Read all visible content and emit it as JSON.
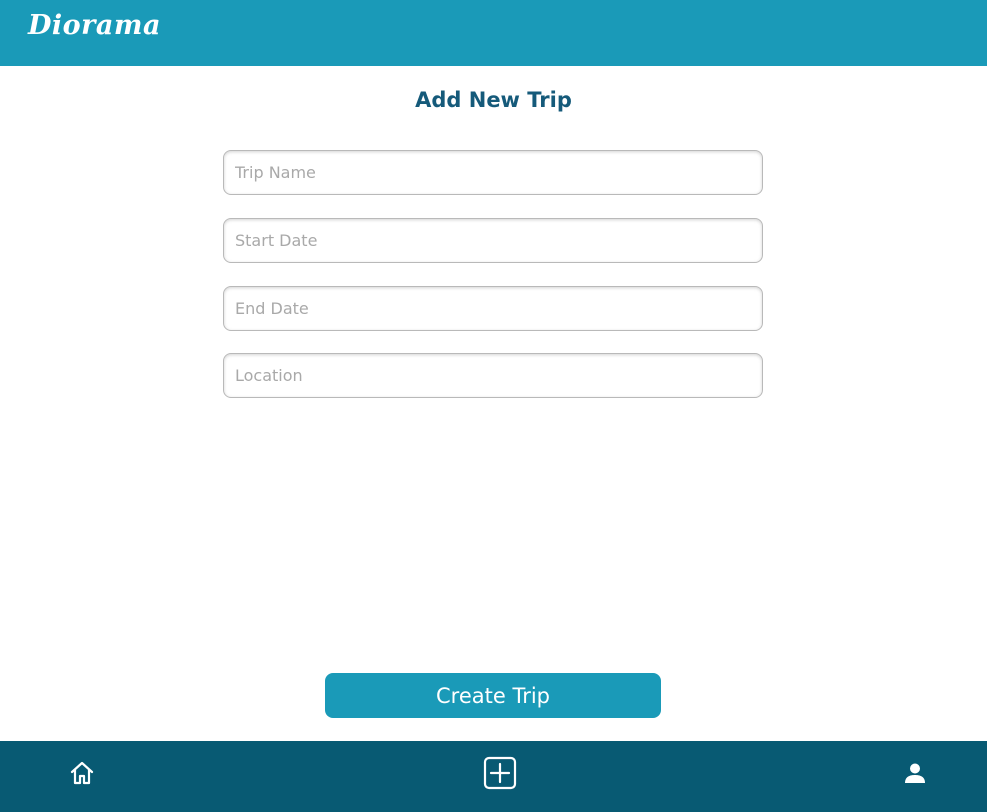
{
  "app": {
    "logo_text": "Diorama"
  },
  "page": {
    "title": "Add New Trip"
  },
  "form": {
    "trip_name": {
      "placeholder": "Trip Name",
      "value": ""
    },
    "start_date": {
      "placeholder": "Start Date",
      "value": ""
    },
    "end_date": {
      "placeholder": "End Date",
      "value": ""
    },
    "location": {
      "placeholder": "Location",
      "value": ""
    },
    "submit_label": "Create Trip"
  },
  "bottom_nav": {
    "items": [
      {
        "icon": "home-icon"
      },
      {
        "icon": "add-square-icon"
      },
      {
        "icon": "person-icon"
      }
    ]
  },
  "colors": {
    "header": "#1a9ab8",
    "bottom_nav": "#085a73",
    "accent": "#1a9ab8",
    "title": "#155a7a"
  }
}
